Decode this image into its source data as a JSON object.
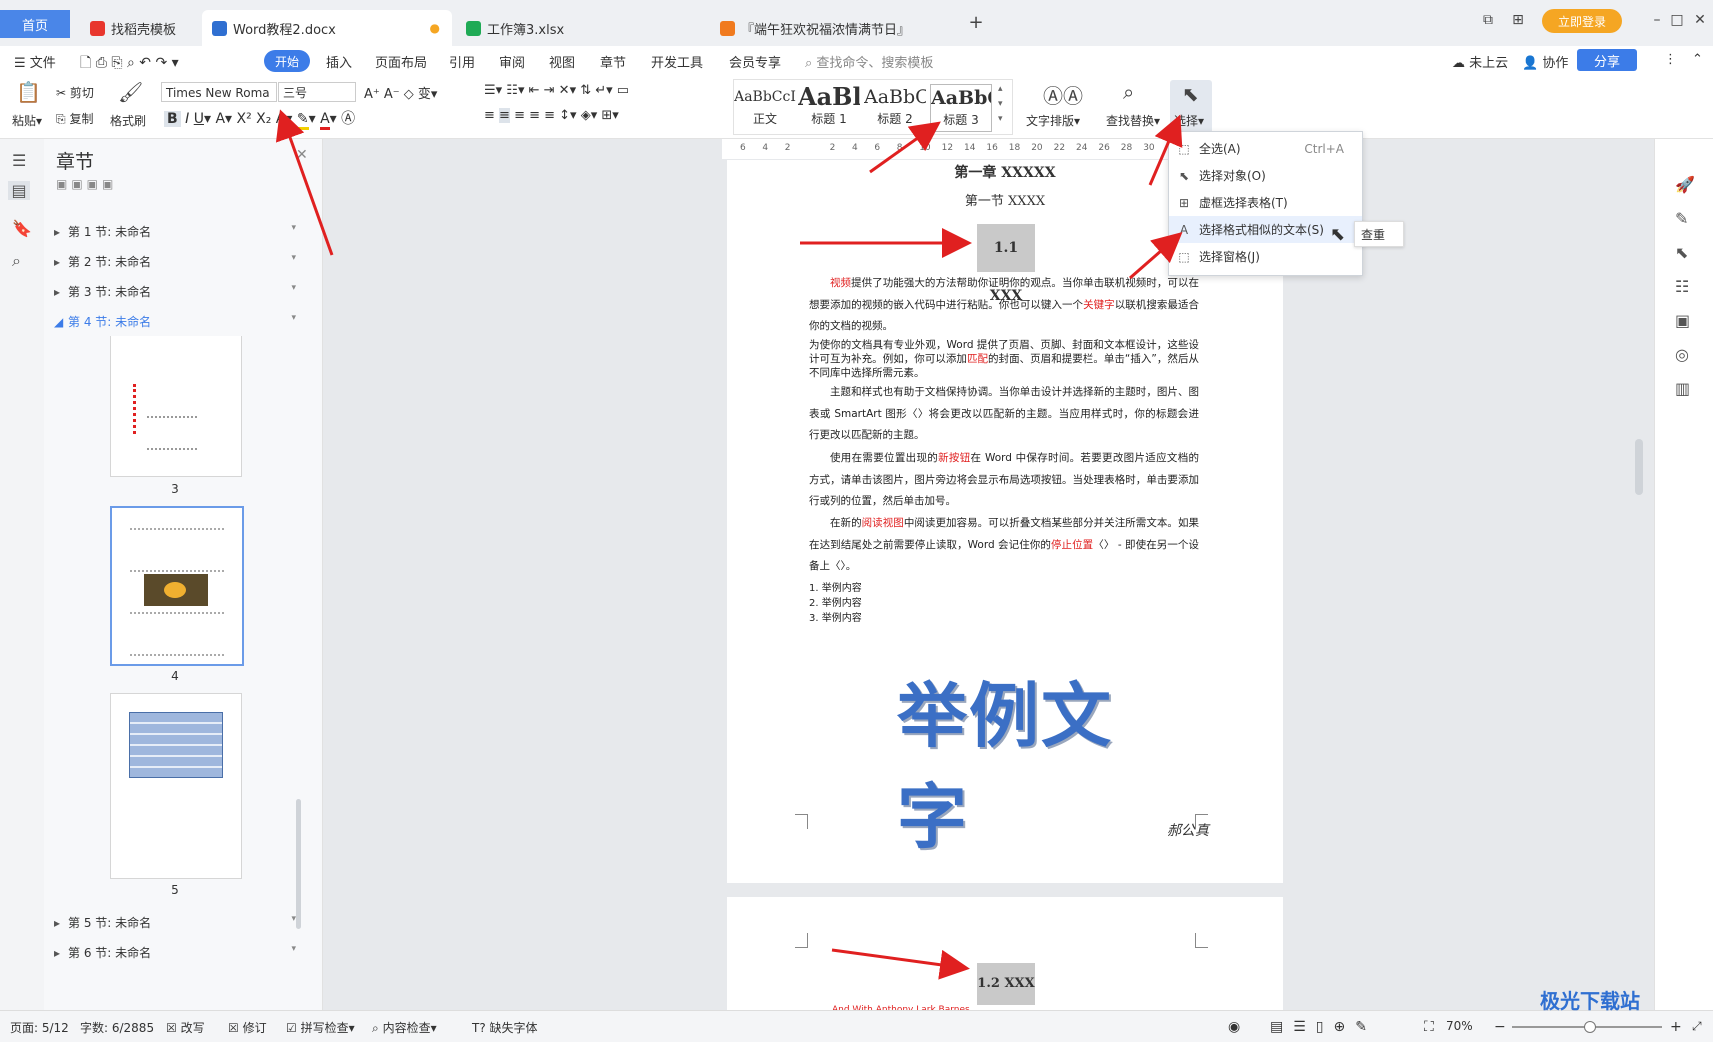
{
  "tabs": {
    "home": "首页",
    "t1": "找稻壳模板",
    "t2": "Word教程2.docx",
    "t3": "工作簿3.xlsx",
    "t4": "『端午狂欢祝福浓情满节日』",
    "login": "立即登录"
  },
  "menu": {
    "file": "文件",
    "start": "开始",
    "insert": "插入",
    "layout": "页面布局",
    "ref": "引用",
    "review": "审阅",
    "view": "视图",
    "chapter": "章节",
    "dev": "开发工具",
    "vip": "会员专享",
    "search_placeholder": "查找命令、搜索模板",
    "cloud": "未上云",
    "collab": "协作",
    "share": "分享"
  },
  "ribbon": {
    "paste": "粘贴",
    "cut": "剪切",
    "copy": "复制",
    "format_painter": "格式刷",
    "font_name": "Times New Roma",
    "font_size": "三号",
    "styles": [
      {
        "sample": "AaBbCcI",
        "label": "正文"
      },
      {
        "sample": "AaBl",
        "label": "标题 1"
      },
      {
        "sample": "AaBbC",
        "label": "标题 2"
      },
      {
        "sample": "AaBbC",
        "label": "标题 3"
      }
    ],
    "text_layout": "文字排版",
    "find_replace": "查找替换",
    "select": "选择"
  },
  "nav": {
    "title": "章节",
    "sections": [
      "第 1 节: 未命名",
      "第 2 节: 未命名",
      "第 3 节: 未命名",
      "第 4 节: 未命名",
      "第 5 节: 未命名",
      "第 6 节: 未命名"
    ],
    "pages": [
      "3",
      "4",
      "5"
    ]
  },
  "ruler": [
    "6",
    "4",
    "2",
    "",
    "2",
    "4",
    "6",
    "8",
    "10",
    "12",
    "14",
    "16",
    "18",
    "20",
    "22",
    "24",
    "26",
    "28",
    "30"
  ],
  "doc": {
    "chapter": "第一章  XXXXX",
    "section": "第一节  XXXX",
    "h11": "1.1 XXX",
    "p1a": "视频",
    "p1b": "提供了功能强大的方法帮助你证明你的观点。当你单击联机视频时，可以在想要添加的视频的嵌入代码中进行粘贴。你也可以键入一个",
    "p1c": "关键字",
    "p1d": "以联机搜索最适合你的文档的视频。",
    "p2a": "为使你的文档具有专业外观，Word 提供了页眉、页脚、封面和文本框设计，这些设计可互为补充。例如，你可以添加",
    "p2b": "匹配",
    "p2c": "的封面、页眉和提要栏。单击“插入”，然后从不同库中选择所需元素。",
    "p3": "主题和样式也有助于文档保持协调。当你单击设计并选择新的主题时，图片、图表或 SmartArt 图形〈〉将会更改以匹配新的主题。当应用样式时，你的标题会进行更改以匹配新的主题。",
    "p4a": "使用在需要位置出现的",
    "p4b": "新按钮",
    "p4c": "在 Word 中保存时间。若要更改图片适应文档的方式，请单击该图片，图片旁边将会显示布局选项按钮。当处理表格时，单击要添加行或列的位置，然后单击加号。",
    "p5a": "在新的",
    "p5b": "阅读视图",
    "p5c": "中阅读更加容易。可以折叠文档某些部分并关注所需文本。如果在达到结尾处之前需要停止读取，Word 会记住你的",
    "p5d": "停止位置",
    "p5e": "〈〉 - 即使在另一个设备上〈〉。",
    "list": [
      "1. 举例内容",
      "2. 举例内容",
      "3. 举例内容"
    ],
    "wordart": "举例文字",
    "signature": "郝公真",
    "h12": "1.2 XXX",
    "p6": "And With Anthony Lark Barnes..."
  },
  "dropdown": {
    "items": [
      {
        "label": "全选(A)",
        "shortcut": "Ctrl+A"
      },
      {
        "label": "选择对象(O)",
        "shortcut": ""
      },
      {
        "label": "虚框选择表格(T)",
        "shortcut": ""
      },
      {
        "label": "选择格式相似的文本(S)",
        "shortcut": ""
      },
      {
        "label": "选择窗格(J)",
        "shortcut": ""
      }
    ],
    "tooltip": "查重"
  },
  "status": {
    "page": "页面: 5/12",
    "words": "字数: 6/2885",
    "revise": "改写",
    "track": "修订",
    "spell": "拼写检查",
    "content": "内容检查",
    "missing_font": "缺失字体",
    "zoom": "70%"
  },
  "watermark": "极光下载站",
  "colors": {
    "accent": "#3c7ce8",
    "login": "#f5a623",
    "arrow": "#e02020",
    "wordart": "#3b6fc5"
  }
}
